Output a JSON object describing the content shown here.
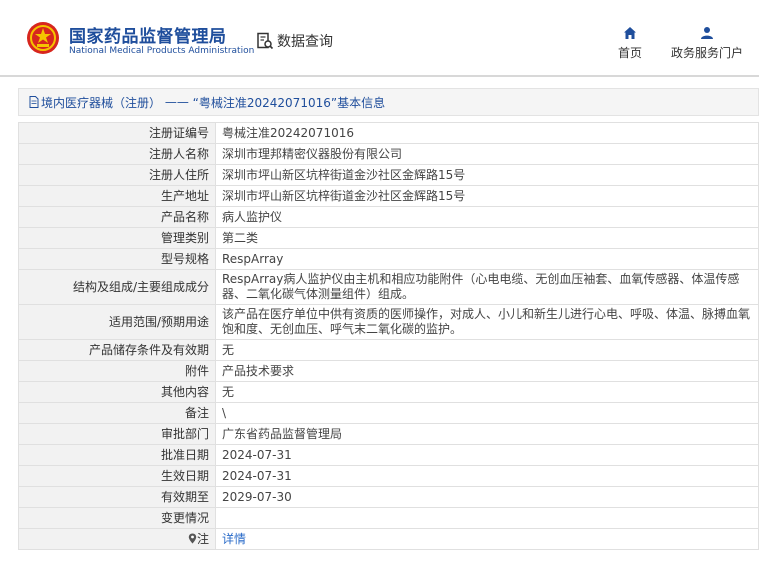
{
  "header": {
    "org_name_cn": "国家药品监督管理局",
    "org_name_en": "National Medical Products Administration",
    "query_label": "数据查询",
    "nav": [
      {
        "label": "首页",
        "icon": "home-icon"
      },
      {
        "label": "政务服务门户",
        "icon": "user-icon"
      }
    ]
  },
  "breadcrumb": {
    "category": "境内医疗器械（注册）",
    "separator": " —— ",
    "title": "“粤械注准20242071016”基本信息"
  },
  "details": {
    "rows": [
      {
        "key": "注册证编号",
        "value": "粤械注准20242071016"
      },
      {
        "key": "注册人名称",
        "value": "深圳市理邦精密仪器股份有限公司"
      },
      {
        "key": "注册人住所",
        "value": "深圳市坪山新区坑梓街道金沙社区金辉路15号"
      },
      {
        "key": "生产地址",
        "value": "深圳市坪山新区坑梓街道金沙社区金辉路15号"
      },
      {
        "key": "产品名称",
        "value": "病人监护仪"
      },
      {
        "key": "管理类别",
        "value": "第二类"
      },
      {
        "key": "型号规格",
        "value": "RespArray"
      },
      {
        "key": "结构及组成/主要组成成分",
        "value": "RespArray病人监护仪由主机和相应功能附件（心电电缆、无创血压袖套、血氧传感器、体温传感器、二氧化碳气体测量组件）组成。"
      },
      {
        "key": "适用范围/预期用途",
        "value": "该产品在医疗单位中供有资质的医师操作，对成人、小儿和新生儿进行心电、呼吸、体温、脉搏血氧饱和度、无创血压、呼气末二氧化碳的监护。"
      },
      {
        "key": "产品储存条件及有效期",
        "value": "无"
      },
      {
        "key": "附件",
        "value": "产品技术要求"
      },
      {
        "key": "其他内容",
        "value": "无"
      },
      {
        "key": "备注",
        "value": "\\"
      },
      {
        "key": "审批部门",
        "value": "广东省药品监督管理局"
      },
      {
        "key": "批准日期",
        "value": "2024-07-31"
      },
      {
        "key": "生效日期",
        "value": "2024-07-31"
      },
      {
        "key": "有效期至",
        "value": "2029-07-30"
      },
      {
        "key": "变更情况",
        "value": ""
      }
    ],
    "note": {
      "key": "注",
      "icon": "location-pin-icon",
      "link_text": "详情"
    }
  }
}
